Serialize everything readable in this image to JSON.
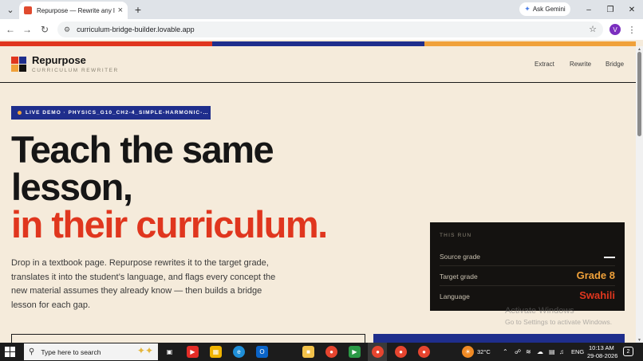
{
  "browser": {
    "tab_title": "Repurpose — Rewrite any lesson",
    "url": "curriculum-bridge-builder.lovable.app",
    "gemini_label": "Ask Gemini",
    "profile_initial": "V"
  },
  "colors": {
    "red": "#e0361e",
    "blue": "#1f2e8c",
    "amber": "#f0a13a",
    "dark": "#141210",
    "cream": "#f5ebdb"
  },
  "header": {
    "brand_name": "Repurpose",
    "brand_tagline": "CURRICULUM REWRITER",
    "nav": [
      "Extract",
      "Rewrite",
      "Bridge"
    ]
  },
  "hero": {
    "badge": "LIVE DEMO · PHYSICS_G10_CH2-4_SIMPLE-HARMONIC-…",
    "headline_line1": "Teach the same",
    "headline_line2": "lesson,",
    "headline_line3": "in their curriculum.",
    "lede": "Drop in a textbook page. Repurpose rewrites it to the target grade, translates it into the student’s language, and flags every concept the new material assumes they already know — then builds a bridge lesson for each gap."
  },
  "run_card": {
    "title": "THIS RUN",
    "rows": [
      {
        "label": "Source grade",
        "value": ""
      },
      {
        "label": "Target grade",
        "value": "Grade 8"
      },
      {
        "label": "Language",
        "value": "Swahili"
      }
    ]
  },
  "watermark": {
    "title": "Activate Windows",
    "subtitle": "Go to Settings to activate Windows."
  },
  "taskbar": {
    "search_placeholder": "Type here to search",
    "weather": "32°C",
    "language": "ENG",
    "time": "10:13 AM",
    "date": "29-08-2026",
    "notification_count": "2"
  }
}
